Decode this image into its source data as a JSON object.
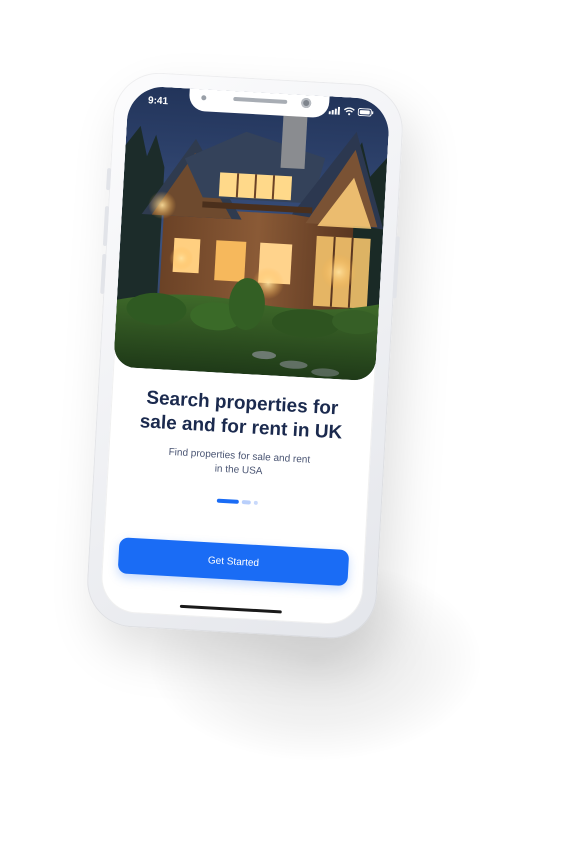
{
  "status_bar": {
    "time": "9:41",
    "icons": [
      "signal-icon",
      "wifi-icon",
      "battery-icon"
    ]
  },
  "hero": {
    "image": "house-night-photo"
  },
  "onboarding": {
    "title": "Search properties for sale and for rent in UK",
    "subtitle": "Find properties for sale and rent in the USA",
    "page_indicator": {
      "total": 3,
      "current": 1
    },
    "cta_label": "Get Started"
  },
  "colors": {
    "primary": "#1a6cf5",
    "title": "#1b2a4e",
    "subtitle": "#4a5573",
    "indicator_inactive": "#b9cffb"
  }
}
